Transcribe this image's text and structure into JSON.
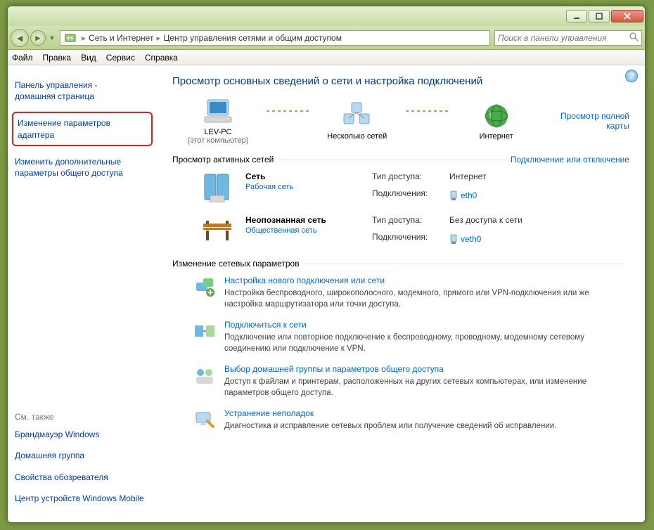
{
  "breadcrumb": {
    "l1": "Сеть и Интернет",
    "l2": "Центр управления сетями и общим доступом"
  },
  "search": {
    "placeholder": "Поиск в панели управления"
  },
  "menu": {
    "file": "Файл",
    "edit": "Правка",
    "view": "Вид",
    "tools": "Сервис",
    "help": "Справка"
  },
  "sidebar": {
    "home": "Панель управления -\nдомашняя страница",
    "adapter": "Изменение параметров адаптера",
    "sharing": "Изменить дополнительные параметры общего доступа",
    "seealso_title": "См. также",
    "seealso": [
      "Брандмауэр Windows",
      "Домашняя группа",
      "Свойства обозревателя",
      "Центр устройств Windows Mobile"
    ]
  },
  "main": {
    "title": "Просмотр основных сведений о сети и настройка подключений",
    "fullmap": "Просмотр полной карты",
    "map": {
      "node1": "LEV-PC",
      "node1sub": "(этот компьютер)",
      "node2": "Несколько сетей",
      "node3": "Интернет"
    },
    "active_head": "Просмотр активных сетей",
    "active_right": "Подключение или отключение",
    "nets": [
      {
        "name": "Сеть",
        "type": "Рабочая сеть",
        "access_lbl": "Тип доступа:",
        "access_val": "Интернет",
        "conn_lbl": "Подключения:",
        "conn_val": "eth0"
      },
      {
        "name": "Неопознанная сеть",
        "type": "Общественная сеть",
        "access_lbl": "Тип доступа:",
        "access_val": "Без доступа к сети",
        "conn_lbl": "Подключения:",
        "conn_val": "veth0"
      }
    ],
    "settings_head": "Изменение сетевых параметров",
    "settings": [
      {
        "title": "Настройка нового подключения или сети",
        "desc": "Настройка беспроводного, широкополосного, модемного, прямого или VPN-подключения или же настройка маршрутизатора или точки доступа."
      },
      {
        "title": "Подключиться к сети",
        "desc": "Подключение или повторное подключение к беспроводному, проводному, модемному сетевому соединению или подключение к VPN."
      },
      {
        "title": "Выбор домашней группы и параметров общего доступа",
        "desc": "Доступ к файлам и принтерам, расположенных на других сетевых компьютерах, или изменение параметров общего доступа."
      },
      {
        "title": "Устранение неполадок",
        "desc": "Диагностика и исправление сетевых проблем или получение сведений об исправлении."
      }
    ]
  }
}
